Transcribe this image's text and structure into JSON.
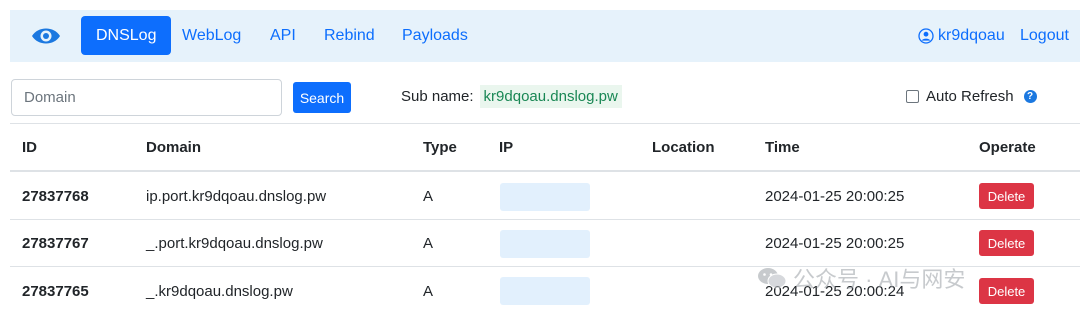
{
  "navbar": {
    "logo": "eye-icon",
    "items": [
      {
        "label": "DNSLog",
        "active": true
      },
      {
        "label": "WebLog",
        "active": false
      },
      {
        "label": "API",
        "active": false
      },
      {
        "label": "Rebind",
        "active": false
      },
      {
        "label": "Payloads",
        "active": false
      }
    ],
    "user": {
      "icon": "user-circle-icon",
      "name": "kr9dqoau"
    },
    "logout_label": "Logout"
  },
  "toolbar": {
    "search_placeholder": "Domain",
    "search_label": "Search",
    "subname_label": "Sub name:",
    "subname_value": "kr9dqoau.dnslog.pw",
    "auto_refresh_label": "Auto Refresh",
    "auto_refresh_checked": false,
    "help_icon": "question-circle-icon"
  },
  "table": {
    "headers": [
      "ID",
      "Domain",
      "Type",
      "IP",
      "Location",
      "Time",
      "Operate"
    ],
    "rows": [
      {
        "id": "27837768",
        "domain": "ip.port.kr9dqoau.dnslog.pw",
        "type": "A",
        "ip": "",
        "location": "",
        "time": "2024-01-25 20:00:25",
        "operate": "Delete"
      },
      {
        "id": "27837767",
        "domain": "_.port.kr9dqoau.dnslog.pw",
        "type": "A",
        "ip": "",
        "location": "",
        "time": "2024-01-25 20:00:25",
        "operate": "Delete"
      },
      {
        "id": "27837765",
        "domain": "_.kr9dqoau.dnslog.pw",
        "type": "A",
        "ip": "",
        "location": "",
        "time": "2024-01-25 20:00:24",
        "operate": "Delete"
      }
    ]
  },
  "watermark": {
    "text": "公众号 · AI与网安",
    "icon": "wechat-icon"
  },
  "colors": {
    "primary": "#0d6efd",
    "navbar_bg": "#e6f2fb",
    "danger": "#dc3545",
    "success": "#198754"
  }
}
